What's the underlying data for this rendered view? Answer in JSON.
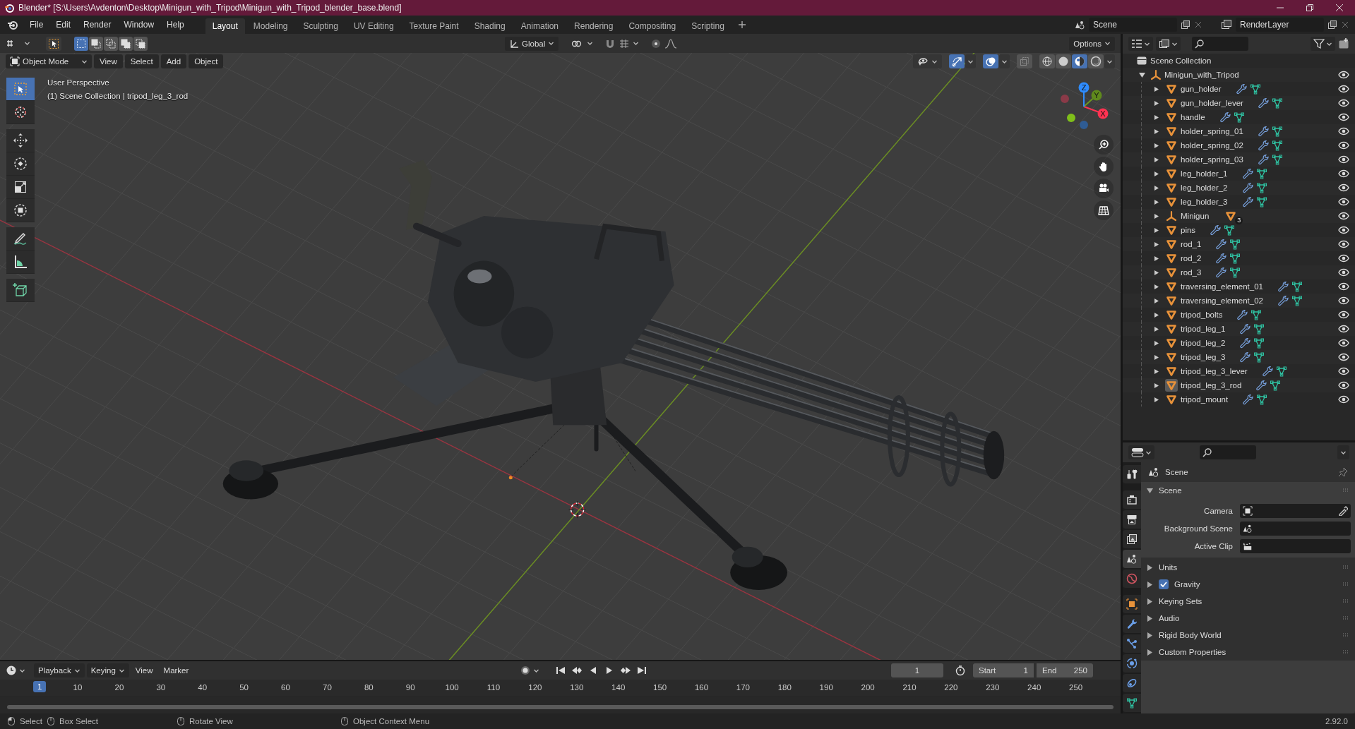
{
  "window": {
    "title": "Blender* [S:\\Users\\Avdenton\\Desktop\\Minigun_with_Tripod\\Minigun_with_Tripod_blender_base.blend]"
  },
  "menu": [
    "File",
    "Edit",
    "Render",
    "Window",
    "Help"
  ],
  "workspaces": [
    {
      "label": "Layout",
      "selected": true
    },
    {
      "label": "Modeling",
      "selected": false
    },
    {
      "label": "Sculpting",
      "selected": false
    },
    {
      "label": "UV Editing",
      "selected": false
    },
    {
      "label": "Texture Paint",
      "selected": false
    },
    {
      "label": "Shading",
      "selected": false
    },
    {
      "label": "Animation",
      "selected": false
    },
    {
      "label": "Rendering",
      "selected": false
    },
    {
      "label": "Compositing",
      "selected": false
    },
    {
      "label": "Scripting",
      "selected": false
    }
  ],
  "scene": "Scene",
  "view_layer": "RenderLayer",
  "tool_header": {
    "select_modes": [
      {
        "selected": true
      },
      {
        "selected": false
      },
      {
        "selected": false
      },
      {
        "selected": false
      },
      {
        "selected": false
      }
    ],
    "orientation": "Global",
    "options": "Options"
  },
  "viewport": {
    "mode": "Object Mode",
    "menus": [
      "View",
      "Select",
      "Add",
      "Object"
    ],
    "view_name": "User Perspective",
    "context": "(1) Scene Collection | tripod_leg_3_rod",
    "tools": [
      {
        "kind": "select",
        "selected": true
      },
      {
        "kind": "cursor",
        "selected": false
      },
      {
        "kind": "move",
        "selected": false
      },
      {
        "kind": "rotate",
        "selected": false
      },
      {
        "kind": "scale",
        "selected": false
      },
      {
        "kind": "transform",
        "selected": false
      },
      {
        "kind": "annotate",
        "selected": false
      },
      {
        "kind": "measure",
        "selected": false
      },
      {
        "kind": "add_cube",
        "selected": false
      }
    ],
    "toggles": [
      {
        "kind": "gizmo",
        "on": true
      },
      {
        "kind": "overlay",
        "on": true
      },
      {
        "kind": "xray",
        "on": false
      }
    ],
    "shading": [
      {
        "kind": "wireframe",
        "selected": false
      },
      {
        "kind": "solid",
        "selected": false
      },
      {
        "kind": "material",
        "selected": true
      },
      {
        "kind": "rendered",
        "selected": false
      }
    ],
    "axes": [
      "X",
      "Y",
      "Z"
    ]
  },
  "outliner": {
    "root": "Scene Collection",
    "collection": {
      "name": "Minigun_with_Tripod",
      "expanded": true,
      "children": [
        {
          "name": "gun_holder",
          "kind": "mesh",
          "selected": false
        },
        {
          "name": "gun_holder_lever",
          "kind": "mesh",
          "selected": false
        },
        {
          "name": "handle",
          "kind": "mesh",
          "selected": false
        },
        {
          "name": "holder_spring_01",
          "kind": "mesh",
          "selected": false
        },
        {
          "name": "holder_spring_02",
          "kind": "mesh",
          "selected": false
        },
        {
          "name": "holder_spring_03",
          "kind": "mesh",
          "selected": false
        },
        {
          "name": "leg_holder_1",
          "kind": "mesh",
          "selected": false
        },
        {
          "name": "leg_holder_2",
          "kind": "mesh",
          "selected": false
        },
        {
          "name": "leg_holder_3",
          "kind": "mesh",
          "selected": false
        },
        {
          "name": "Minigun",
          "kind": "empty",
          "badge": "3",
          "selected": false
        },
        {
          "name": "pins",
          "kind": "mesh",
          "selected": false
        },
        {
          "name": "rod_1",
          "kind": "mesh",
          "selected": false
        },
        {
          "name": "rod_2",
          "kind": "mesh",
          "selected": false
        },
        {
          "name": "rod_3",
          "kind": "mesh",
          "selected": false
        },
        {
          "name": "traversing_element_01",
          "kind": "mesh",
          "selected": false
        },
        {
          "name": "traversing_element_02",
          "kind": "mesh",
          "selected": false
        },
        {
          "name": "tripod_bolts",
          "kind": "mesh",
          "selected": false
        },
        {
          "name": "tripod_leg_1",
          "kind": "mesh",
          "selected": false
        },
        {
          "name": "tripod_leg_2",
          "kind": "mesh",
          "selected": false
        },
        {
          "name": "tripod_leg_3",
          "kind": "mesh",
          "selected": false
        },
        {
          "name": "tripod_leg_3_lever",
          "kind": "mesh",
          "selected": false
        },
        {
          "name": "tripod_leg_3_rod",
          "kind": "mesh",
          "selected": true
        },
        {
          "name": "tripod_mount",
          "kind": "mesh",
          "selected": false
        }
      ]
    }
  },
  "properties": {
    "tabs": [
      {
        "kind": "tool",
        "selected": false
      },
      {
        "kind": "render",
        "selected": false
      },
      {
        "kind": "output",
        "selected": false
      },
      {
        "kind": "view_layer",
        "selected": false
      },
      {
        "kind": "scene",
        "selected": true
      },
      {
        "kind": "world",
        "selected": false
      },
      {
        "kind": "object",
        "selected": false
      },
      {
        "kind": "modifiers",
        "selected": false
      },
      {
        "kind": "particles",
        "selected": false
      },
      {
        "kind": "physics",
        "selected": false
      },
      {
        "kind": "constraints",
        "selected": false
      },
      {
        "kind": "data",
        "selected": false
      }
    ],
    "context": "Scene",
    "panel": {
      "title": "Scene",
      "expanded": true,
      "fields": [
        {
          "label": "Camera",
          "kind": "camera"
        },
        {
          "label": "Background Scene",
          "kind": "scene"
        },
        {
          "label": "Active Clip",
          "kind": "clip"
        }
      ]
    },
    "subpanels": [
      {
        "title": "Units",
        "expanded": false
      },
      {
        "title": "Gravity",
        "expanded": false,
        "checked": true
      },
      {
        "title": "Keying Sets",
        "expanded": false
      },
      {
        "title": "Audio",
        "expanded": false
      },
      {
        "title": "Rigid Body World",
        "expanded": false
      },
      {
        "title": "Custom Properties",
        "expanded": false
      }
    ]
  },
  "timeline": {
    "menus": [
      {
        "label": "Playback",
        "dropdown": true
      },
      {
        "label": "Keying",
        "dropdown": true
      },
      {
        "label": "View",
        "dropdown": false
      },
      {
        "label": "Marker",
        "dropdown": false
      }
    ],
    "current_frame": "1",
    "start_label": "Start",
    "start": "1",
    "end_label": "End",
    "end": "250",
    "playhead": "1",
    "ruler": [
      "10",
      "20",
      "30",
      "40",
      "50",
      "60",
      "70",
      "80",
      "90",
      "100",
      "110",
      "120",
      "130",
      "140",
      "150",
      "160",
      "170",
      "180",
      "190",
      "200",
      "210",
      "220",
      "230",
      "240",
      "250"
    ]
  },
  "status_bar": {
    "hints": [
      "Select",
      "Box Select",
      "Rotate View",
      "Object Context Menu"
    ],
    "version": "2.92.0"
  }
}
